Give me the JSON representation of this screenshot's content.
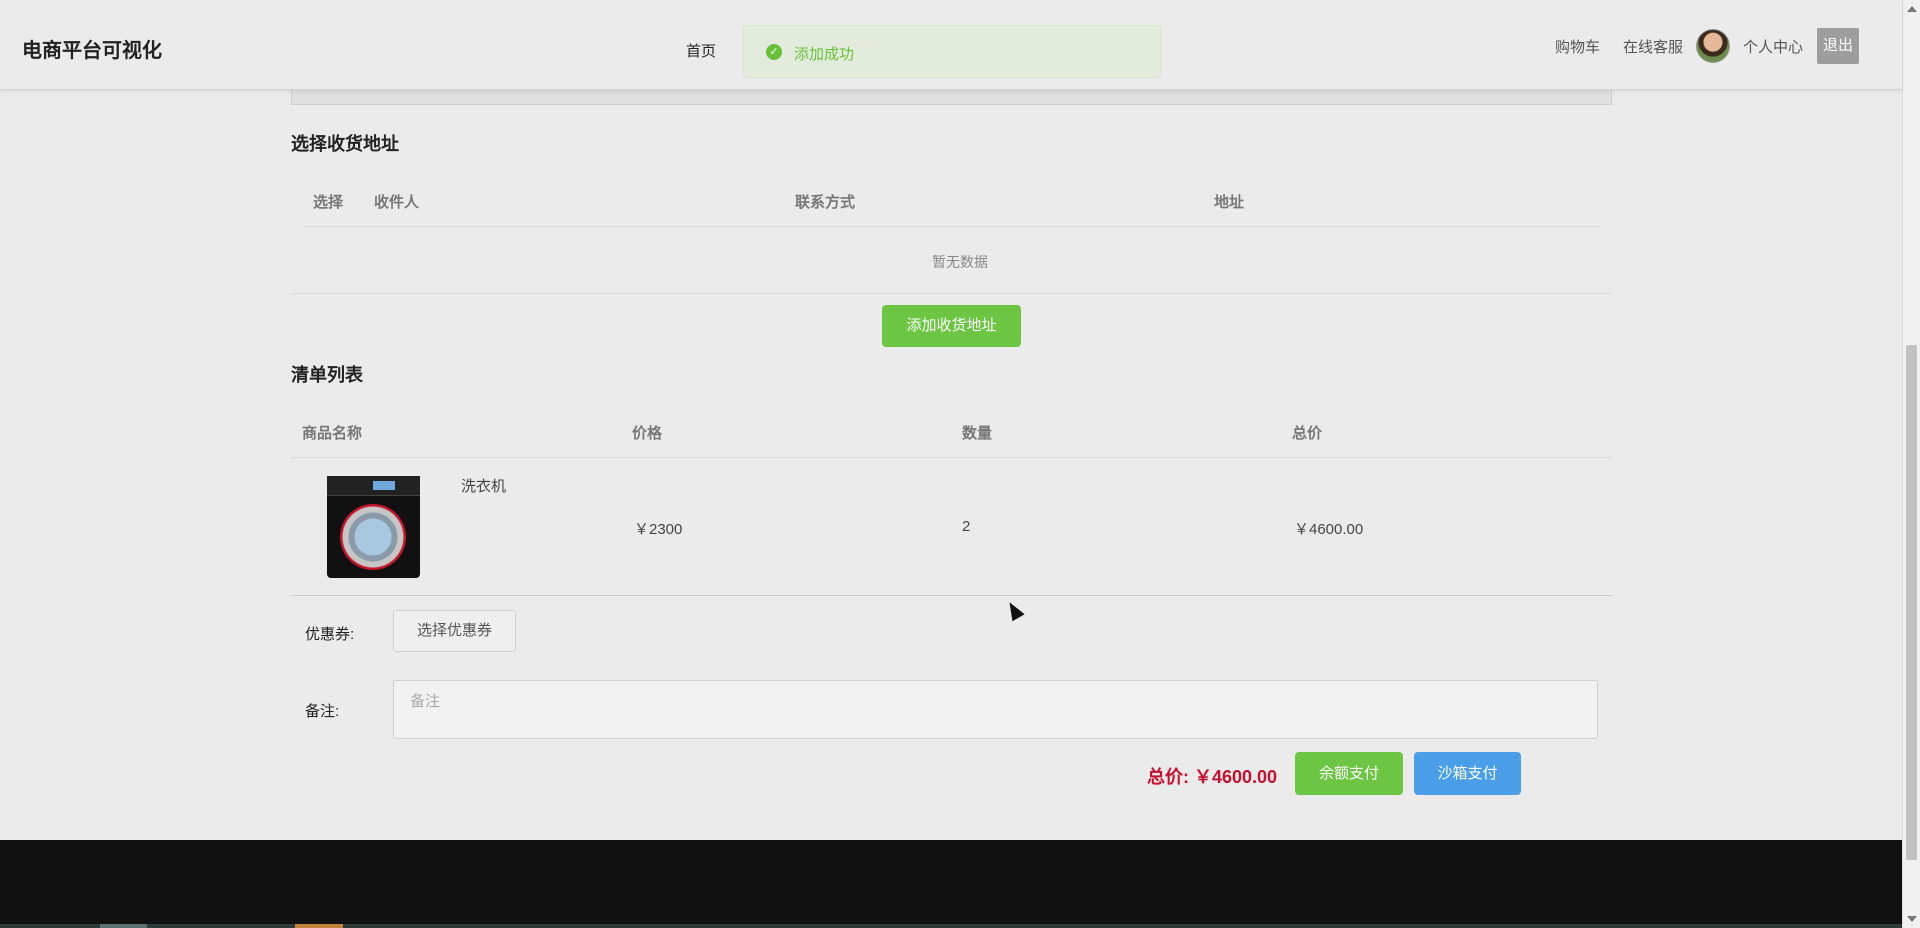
{
  "header": {
    "brand": "电商平台可视化",
    "nav_home": "首页",
    "toast": "添加成功",
    "cart": "购物车",
    "service": "在线客服",
    "profile": "个人中心",
    "logout": "退出"
  },
  "address": {
    "title": "选择收货地址",
    "columns": [
      "选择",
      "收件人",
      "联系方式",
      "地址"
    ],
    "empty_text": "暂无数据",
    "add_button": "添加收货地址"
  },
  "order_list": {
    "title": "清单列表",
    "columns": [
      "商品名称",
      "价格",
      "数量",
      "总价"
    ],
    "items": [
      {
        "name": "洗衣机",
        "price": "￥2300",
        "quantity": "2",
        "total": "￥4600.00"
      }
    ]
  },
  "coupon": {
    "label": "优惠券:",
    "button": "选择优惠券"
  },
  "remark": {
    "label": "备注:",
    "placeholder": "备注"
  },
  "payment": {
    "total_label": "总价: ￥4600.00",
    "balance_button": "余额支付",
    "sandbox_button": "沙箱支付"
  },
  "colors": {
    "accent_green": "#6cc644",
    "accent_blue": "#4a9fe8",
    "price_red": "#c8102e",
    "toast_green": "#67c23a"
  },
  "icons": [
    "check-circle-icon",
    "avatar",
    "mouse-cursor-icon"
  ]
}
